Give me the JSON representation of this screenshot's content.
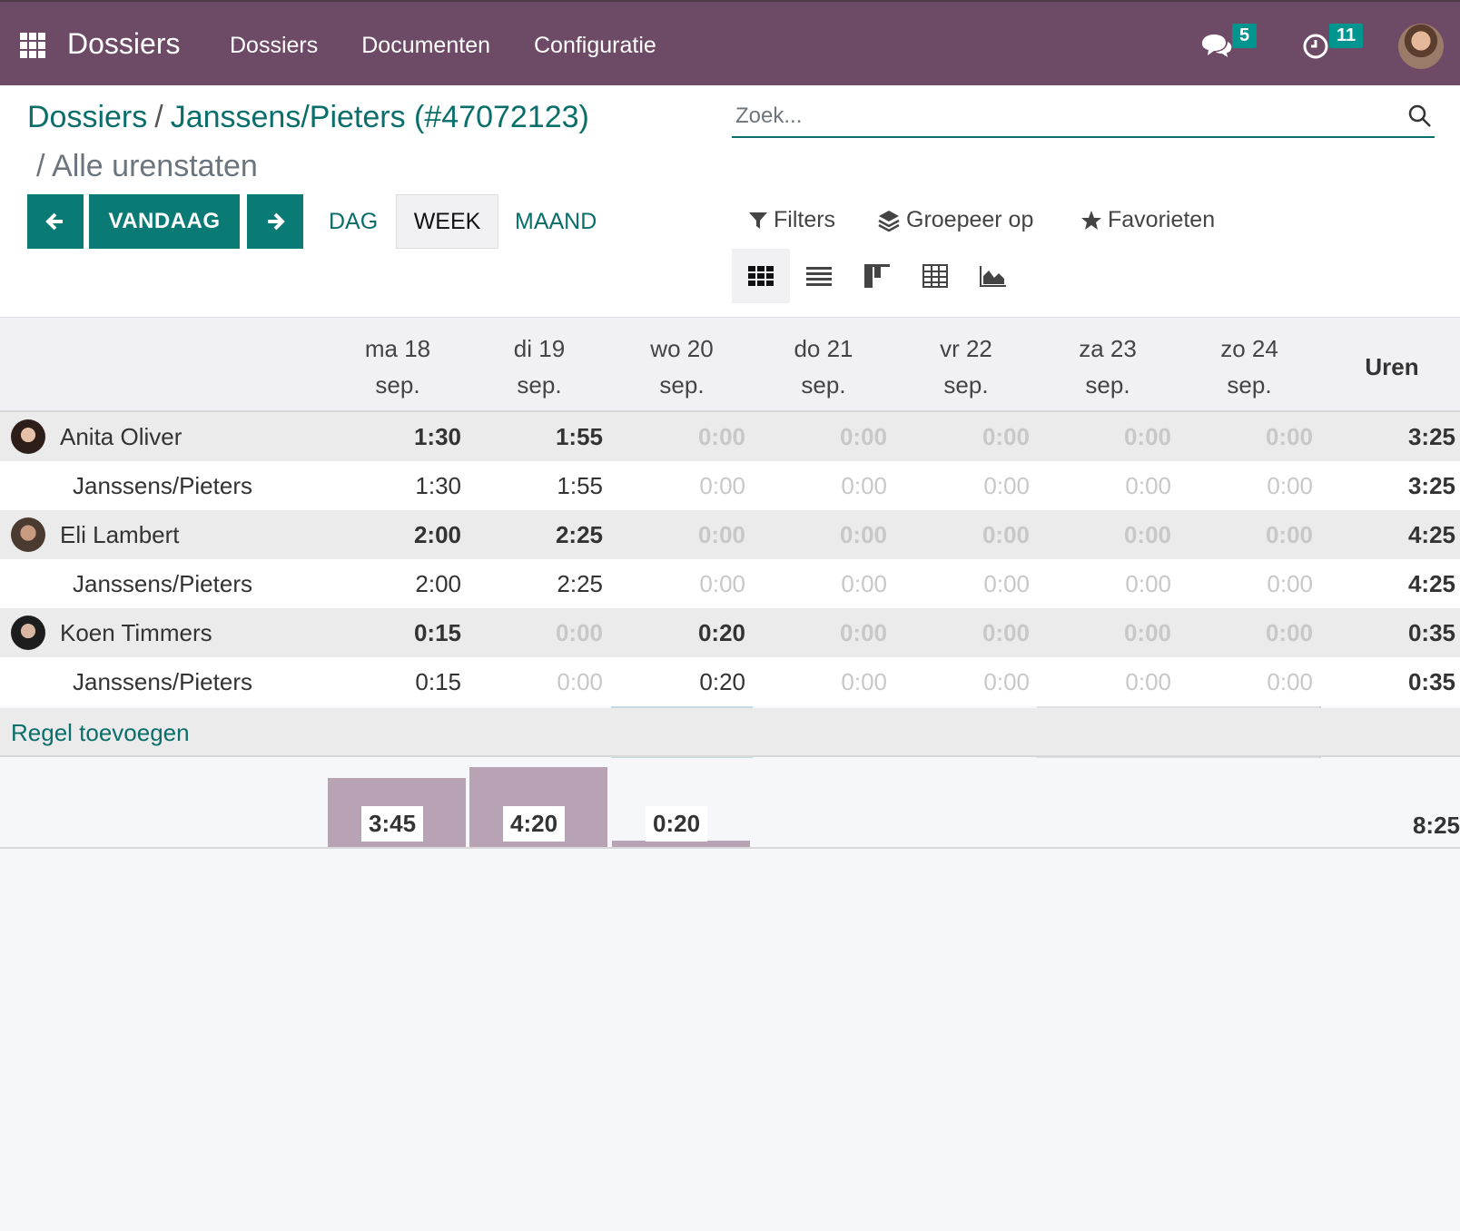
{
  "navbar": {
    "app_name": "Dossiers",
    "menu": [
      "Dossiers",
      "Documenten",
      "Configuratie"
    ],
    "messages_count": "5",
    "activities_count": "11",
    "color": "#6d4a65"
  },
  "breadcrumb": {
    "parent": "Dossiers",
    "record": "Janssens/Pieters (#47072123)",
    "current": "/ Alle urenstaten"
  },
  "search": {
    "placeholder": "Zoek..."
  },
  "toolbar": {
    "today_label": "VANDAAG",
    "ranges": [
      "DAG",
      "WEEK",
      "MAAND"
    ],
    "active_range": "WEEK",
    "filters_label": "Filters",
    "group_label": "Groepeer op",
    "favorites_label": "Favorieten",
    "views": [
      "grid-icon",
      "list-icon",
      "kanban-icon",
      "pivot-icon",
      "graph-icon"
    ],
    "active_view": "grid-icon"
  },
  "grid": {
    "days": [
      {
        "day": "ma 18",
        "month": "sep."
      },
      {
        "day": "di 19",
        "month": "sep."
      },
      {
        "day": "wo 20",
        "month": "sep."
      },
      {
        "day": "do 21",
        "month": "sep."
      },
      {
        "day": "vr 22",
        "month": "sep."
      },
      {
        "day": "za 23",
        "month": "sep."
      },
      {
        "day": "zo 24",
        "month": "sep."
      }
    ],
    "total_header": "Uren",
    "rows": [
      {
        "type": "group",
        "name": "Anita Oliver",
        "values": [
          "1:30",
          "1:55",
          "0:00",
          "0:00",
          "0:00",
          "0:00",
          "0:00"
        ],
        "total": "3:25"
      },
      {
        "type": "line",
        "name": "Janssens/Pieters",
        "values": [
          "1:30",
          "1:55",
          "0:00",
          "0:00",
          "0:00",
          "0:00",
          "0:00"
        ],
        "total": "3:25"
      },
      {
        "type": "group",
        "name": "Eli Lambert",
        "values": [
          "2:00",
          "2:25",
          "0:00",
          "0:00",
          "0:00",
          "0:00",
          "0:00"
        ],
        "total": "4:25"
      },
      {
        "type": "line",
        "name": "Janssens/Pieters",
        "values": [
          "2:00",
          "2:25",
          "0:00",
          "0:00",
          "0:00",
          "0:00",
          "0:00"
        ],
        "total": "4:25"
      },
      {
        "type": "group",
        "name": "Koen Timmers",
        "values": [
          "0:15",
          "0:00",
          "0:20",
          "0:00",
          "0:00",
          "0:00",
          "0:00"
        ],
        "total": "0:35"
      },
      {
        "type": "line",
        "name": "Janssens/Pieters",
        "values": [
          "0:15",
          "0:00",
          "0:20",
          "0:00",
          "0:00",
          "0:00",
          "0:00"
        ],
        "total": "0:35"
      }
    ],
    "add_line_label": "Regel toevoegen",
    "day_totals": [
      "3:45",
      "4:20",
      "0:20",
      "",
      "",
      "",
      ""
    ],
    "day_total_hours": [
      3.75,
      4.333,
      0.333,
      0,
      0,
      0,
      0
    ],
    "grand_total": "8:25",
    "bar_color": "#b8a3b4",
    "today_color": "#aecdd3"
  }
}
